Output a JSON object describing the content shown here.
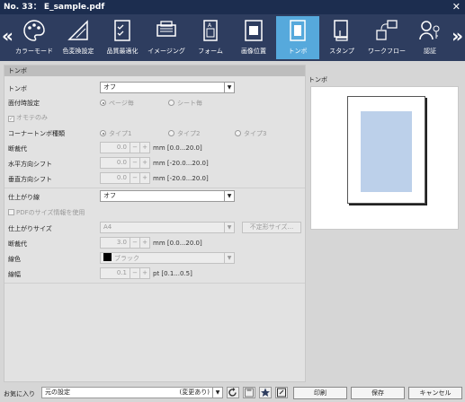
{
  "window": {
    "title": "No. 33： E_sample.pdf"
  },
  "toolbar": {
    "tools": [
      {
        "label": "カラーモード",
        "icon": "palette-icon"
      },
      {
        "label": "色変換設定",
        "icon": "color-conversion-icon"
      },
      {
        "label": "品質最適化",
        "icon": "quality-check-icon"
      },
      {
        "label": "イメージング",
        "icon": "printer-icon"
      },
      {
        "label": "フォーム",
        "icon": "form-icon"
      },
      {
        "label": "画像位置",
        "icon": "image-position-icon"
      },
      {
        "label": "トンボ",
        "icon": "crop-marks-icon",
        "active": true
      },
      {
        "label": "スタンプ",
        "icon": "stamp-icon"
      },
      {
        "label": "ワークフロー",
        "icon": "workflow-icon"
      },
      {
        "label": "認証",
        "icon": "auth-icon"
      }
    ]
  },
  "tombo": {
    "section_title": "トンボ",
    "tombo_label": "トンボ",
    "tombo_value": "オフ",
    "imposition_label": "面付時設定",
    "radio_page": "ページ毎",
    "radio_sheet": "シート毎",
    "front_only": "オモテのみ",
    "corner_label": "コーナートンボ種類",
    "type1": "タイプ1",
    "type2": "タイプ2",
    "type3": "タイプ3",
    "bleed_label": "断裁代",
    "bleed_value": "0.0",
    "bleed_unit": "mm [0.0...20.0]",
    "hshift_label": "水平方向シフト",
    "hshift_value": "0.0",
    "hshift_unit": "mm [-20.0...20.0]",
    "vshift_label": "垂直方向シフト",
    "vshift_value": "0.0",
    "vshift_unit": "mm [-20.0...20.0]"
  },
  "finish": {
    "trim_line_label": "仕上がり線",
    "trim_line_value": "オフ",
    "use_pdf_size": "PDFのサイズ情報を使用",
    "size_label": "仕上がりサイズ",
    "size_value": "A4",
    "custom_size_button": "不定形サイズ...",
    "bleed_label": "断裁代",
    "bleed_value": "3.0",
    "bleed_unit": "mm [0.0...20.0]",
    "line_color_label": "線色",
    "line_color_value": "ブラック",
    "line_width_label": "線幅",
    "line_width_value": "0.1",
    "line_width_unit": "pt [0.1...0.5]"
  },
  "preview": {
    "title": "トンボ"
  },
  "footer": {
    "favorites_label": "お気に入り",
    "favorites_value": "元の設定",
    "favorites_state": "(変更あり)",
    "print_button": "印刷",
    "save_button": "保存",
    "cancel_button": "キャンセル"
  },
  "colors": {
    "title_bar": "#1c2d4f",
    "toolbar": "#2e3d5f",
    "active_tab": "#56a9dc",
    "preview_trim": "#bcd0ea"
  }
}
